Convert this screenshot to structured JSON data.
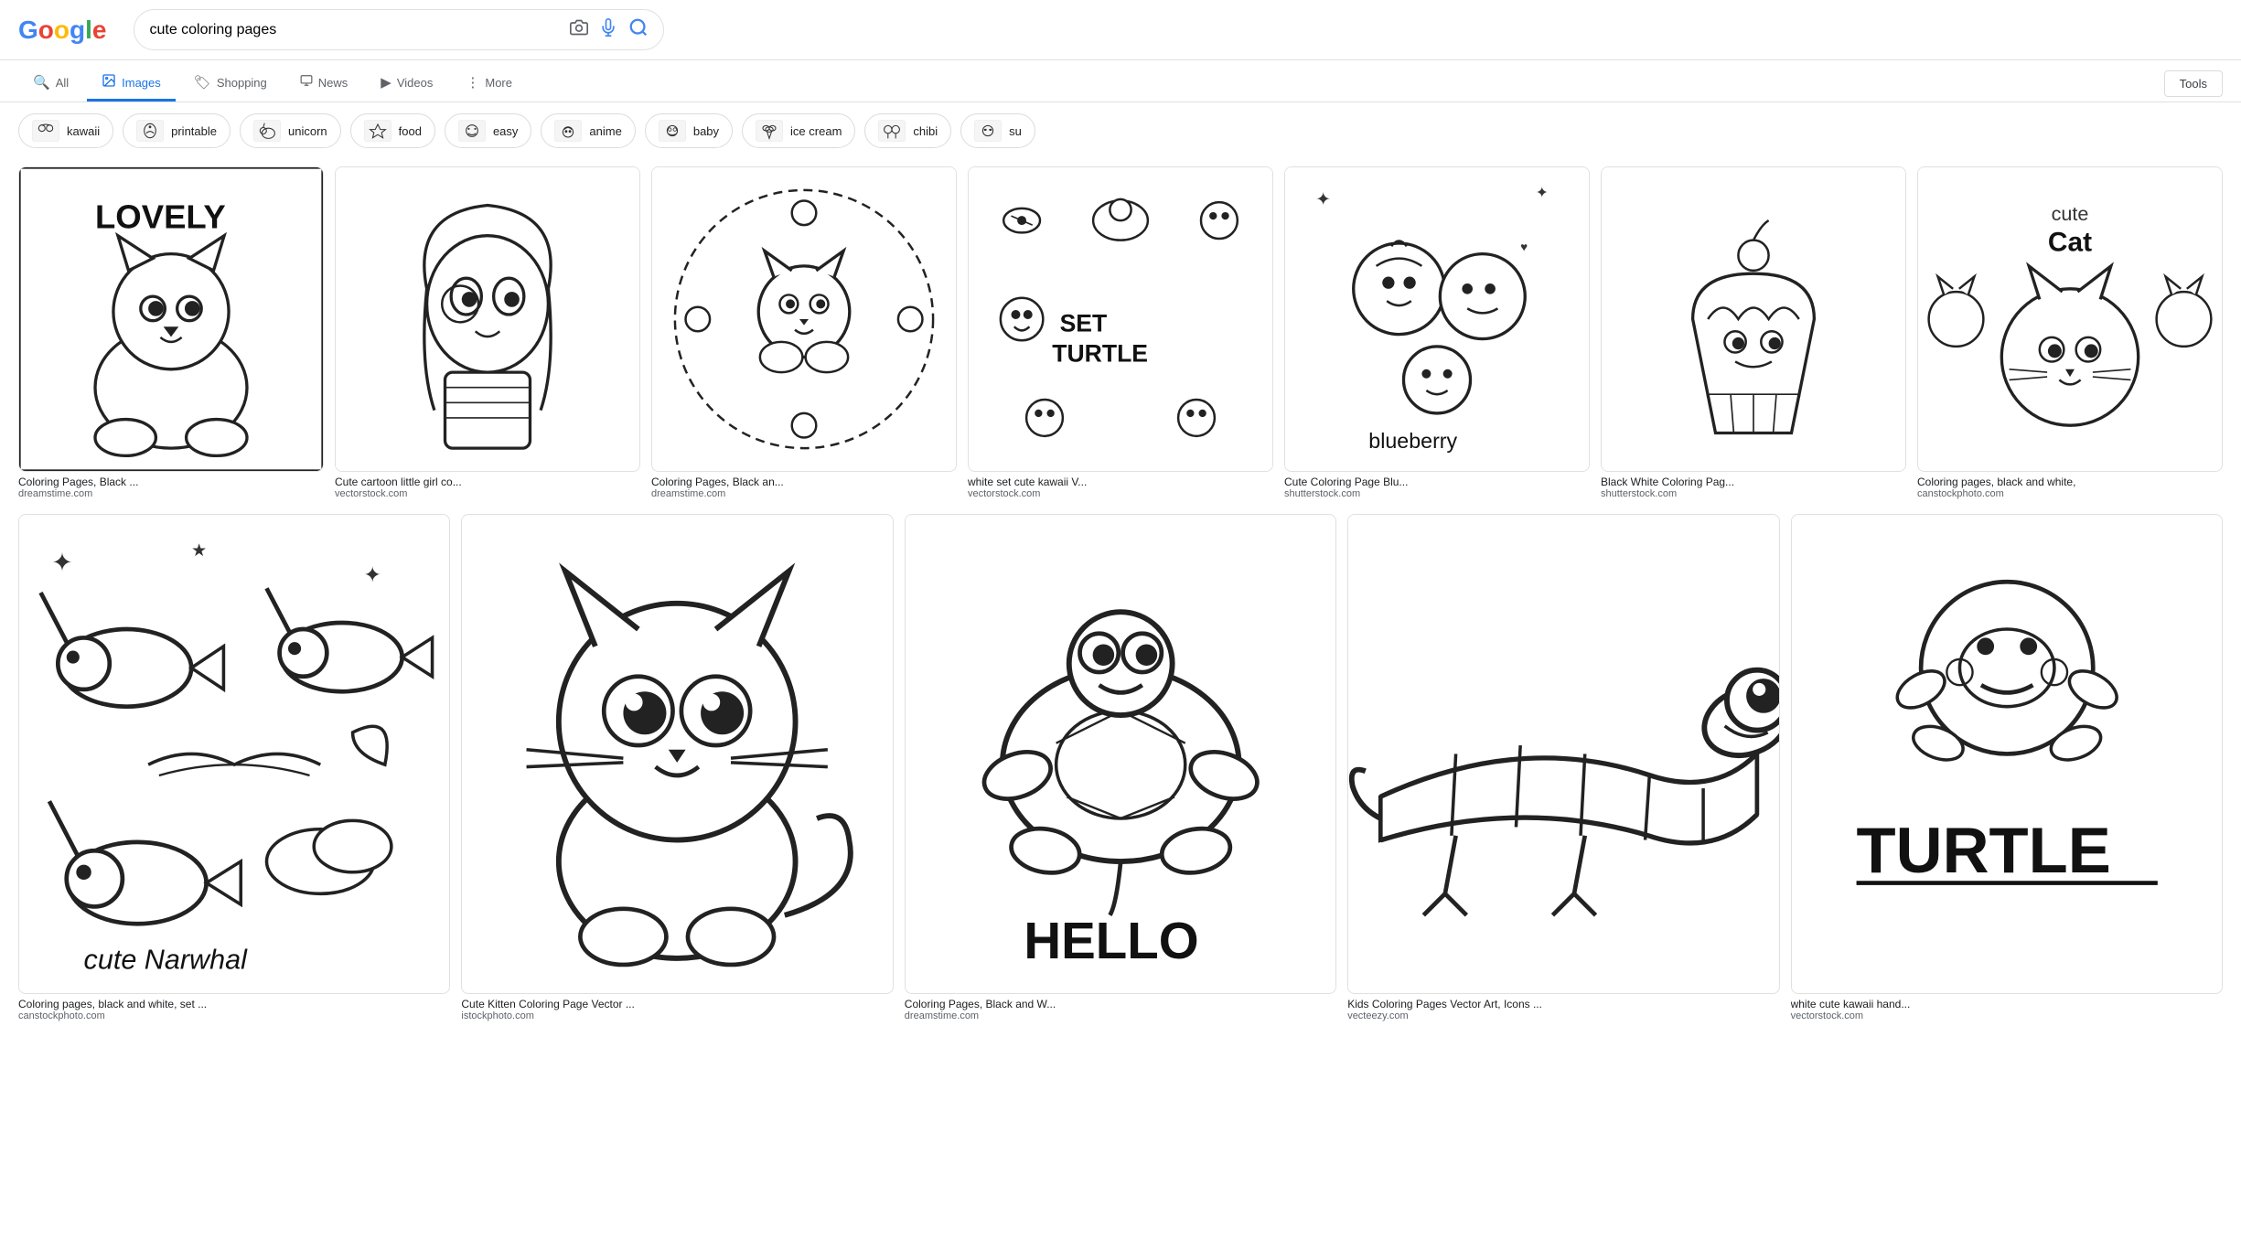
{
  "search": {
    "query": "cute coloring pages",
    "placeholder": "cute coloring pages"
  },
  "nav": {
    "tabs": [
      {
        "id": "all",
        "label": "All",
        "icon": "🔍",
        "active": false
      },
      {
        "id": "images",
        "label": "Images",
        "icon": "🖼",
        "active": true
      },
      {
        "id": "shopping",
        "label": "Shopping",
        "icon": "🏷",
        "active": false
      },
      {
        "id": "news",
        "label": "News",
        "icon": "📰",
        "active": false
      },
      {
        "id": "videos",
        "label": "Videos",
        "icon": "▶",
        "active": false
      },
      {
        "id": "more",
        "label": "More",
        "icon": "⋮",
        "active": false
      }
    ],
    "tools_label": "Tools"
  },
  "chips": [
    {
      "id": "kawaii",
      "label": "kawaii",
      "emoji": "👀"
    },
    {
      "id": "printable",
      "label": "printable",
      "emoji": "🐱"
    },
    {
      "id": "unicorn",
      "label": "unicorn",
      "emoji": "🦄"
    },
    {
      "id": "food",
      "label": "food",
      "emoji": "🧁"
    },
    {
      "id": "easy",
      "label": "easy",
      "emoji": "🍬"
    },
    {
      "id": "anime",
      "label": "anime",
      "emoji": "🌸"
    },
    {
      "id": "baby",
      "label": "baby",
      "emoji": "🌺"
    },
    {
      "id": "ice_cream",
      "label": "ice cream",
      "emoji": "🍦"
    },
    {
      "id": "chibi",
      "label": "chibi",
      "emoji": "👯"
    },
    {
      "id": "su",
      "label": "su",
      "emoji": "🕶"
    }
  ],
  "top_row": [
    {
      "title": "Coloring Pages, Black ...",
      "source": "dreamstime.com"
    },
    {
      "title": "Cute cartoon little girl co...",
      "source": "vectorstock.com"
    },
    {
      "title": "Coloring Pages, Black an...",
      "source": "dreamstime.com"
    },
    {
      "title": "white set cute kawaii V...",
      "source": "vectorstock.com"
    },
    {
      "title": "Cute Coloring Page Blu...",
      "source": "shutterstock.com"
    },
    {
      "title": "Black White Coloring Pag...",
      "source": "shutterstock.com"
    },
    {
      "title": "Coloring pages, black and white,",
      "source": "canstockphoto.com"
    }
  ],
  "bottom_row": [
    {
      "title": "Coloring pages, black and white, set ...",
      "source": "canstockphoto.com"
    },
    {
      "title": "Cute Kitten Coloring Page Vector ...",
      "source": "istockphoto.com"
    },
    {
      "title": "Coloring Pages, Black and W...",
      "source": "dreamstime.com"
    },
    {
      "title": "Kids Coloring Pages Vector Art, Icons ...",
      "source": "vecteezy.com"
    },
    {
      "title": "white cute kawaii hand...",
      "source": "vectorstock.com"
    }
  ],
  "logo": {
    "letters": [
      {
        "char": "G",
        "color": "#4285F4"
      },
      {
        "char": "o",
        "color": "#EA4335"
      },
      {
        "char": "o",
        "color": "#FBBC05"
      },
      {
        "char": "g",
        "color": "#4285F4"
      },
      {
        "char": "l",
        "color": "#34A853"
      },
      {
        "char": "e",
        "color": "#EA4335"
      }
    ]
  }
}
